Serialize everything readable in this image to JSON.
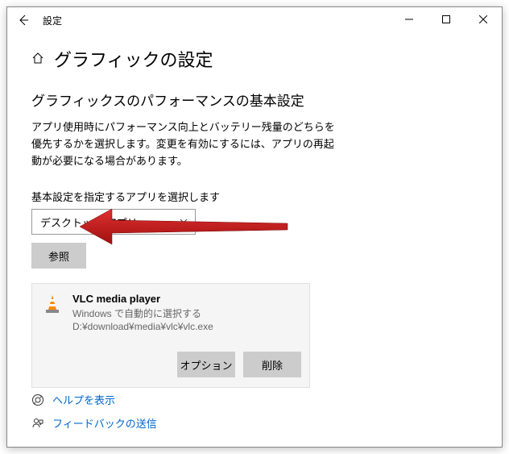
{
  "titlebar": {
    "title": "設定"
  },
  "page": {
    "heading": "グラフィックの設定",
    "section_heading": "グラフィックスのパフォーマンスの基本設定",
    "description": "アプリ使用時にパフォーマンス向上とバッテリー残量のどちらを優先するかを選択します。変更を有効にするには、アプリの再起動が必要になる場合があります。",
    "select_label": "基本設定を指定するアプリを選択します",
    "select_value": "デスクトップ アプリ",
    "browse_label": "参照"
  },
  "app": {
    "name": "VLC media player",
    "subtitle": "Windows で自動的に選択する",
    "path": "D:¥download¥media¥vlc¥vlc.exe",
    "options_label": "オプション",
    "remove_label": "削除"
  },
  "footer": {
    "help_label": "ヘルプを表示",
    "feedback_label": "フィードバックの送信"
  }
}
